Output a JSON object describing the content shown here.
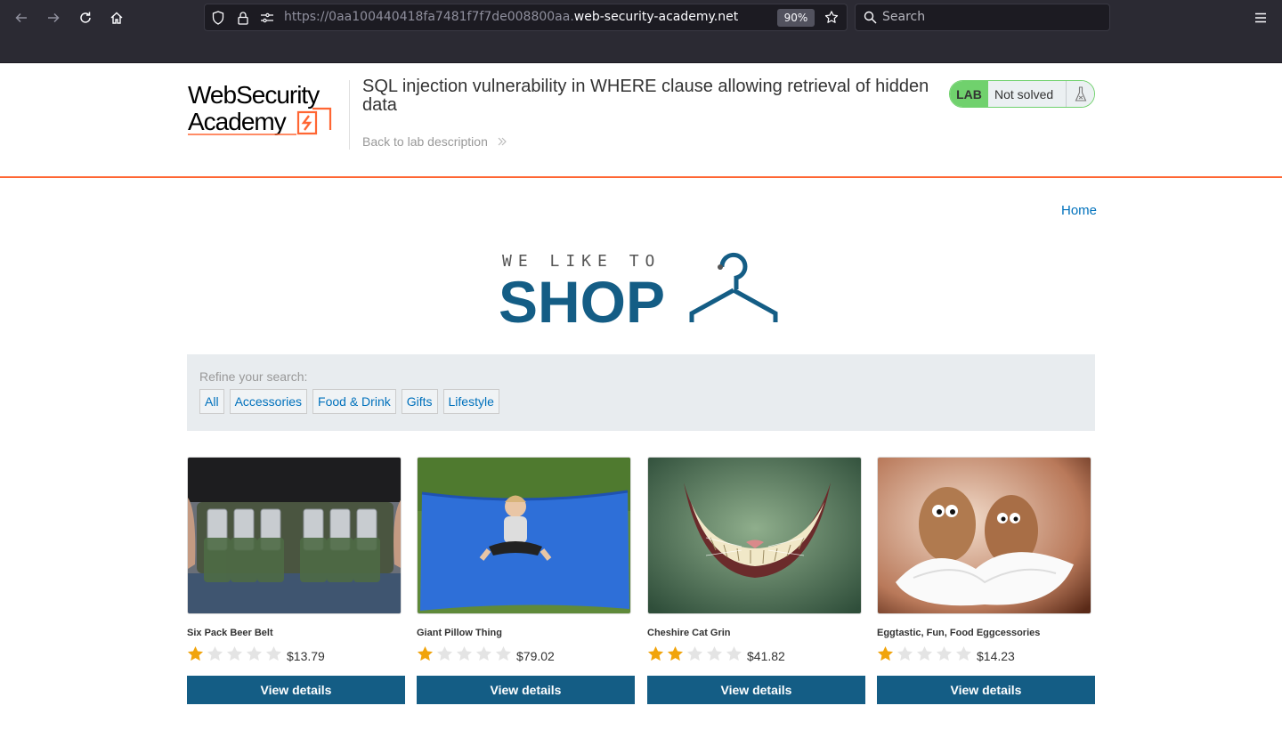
{
  "browser": {
    "url_prefix": "https://0aa100440418fa7481f7f7de008800aa.",
    "url_domain": "web-security-academy.net",
    "zoom": "90%",
    "search_placeholder": "Search"
  },
  "lab": {
    "logo_line1": "WebSecurity",
    "logo_line2": "Academy",
    "title": "SQL injection vulnerability in WHERE clause allowing retrieval of hidden data",
    "back_link": "Back to lab description",
    "badge": "LAB",
    "status": "Not solved",
    "accent_color": "#ff6633",
    "status_color": "#70d16d"
  },
  "shop": {
    "home_link": "Home",
    "logo_top": "WE LIKE TO",
    "logo_main": "SHOP",
    "refine_label": "Refine your search:",
    "filters": [
      "All",
      "Accessories",
      "Food & Drink",
      "Gifts",
      "Lifestyle"
    ],
    "brand_color": "#145d85"
  },
  "products": [
    {
      "name": "Six Pack Beer Belt",
      "rating": 1,
      "price": "$13.79",
      "button": "View details"
    },
    {
      "name": "Giant Pillow Thing",
      "rating": 1,
      "price": "$79.02",
      "button": "View details"
    },
    {
      "name": "Cheshire Cat Grin",
      "rating": 2,
      "price": "$41.82",
      "button": "View details"
    },
    {
      "name": "Eggtastic, Fun, Food Eggcessories",
      "rating": 1,
      "price": "$14.23",
      "button": "View details"
    }
  ]
}
